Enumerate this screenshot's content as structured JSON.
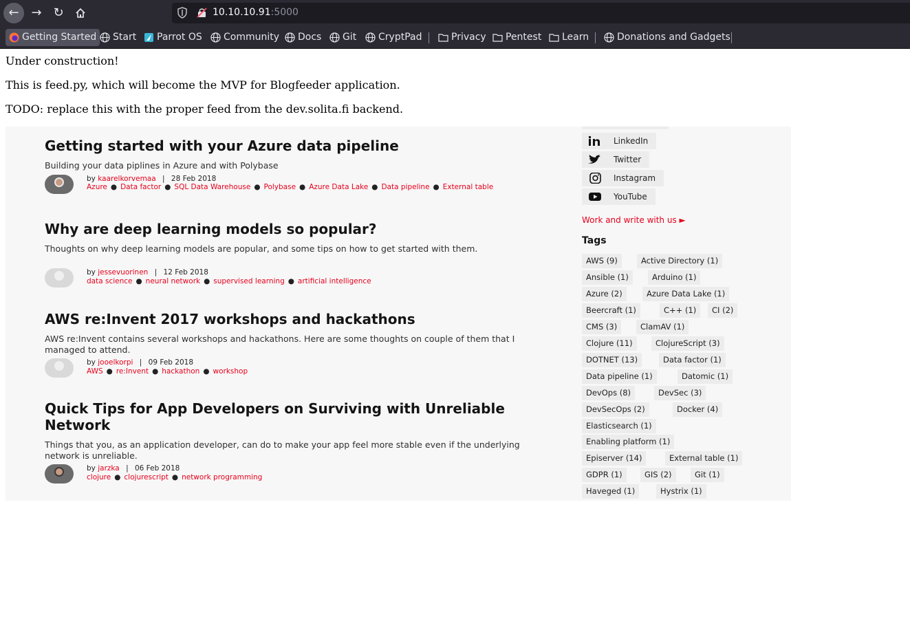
{
  "browser": {
    "url_host": "10.10.10.91",
    "url_port": ":5000",
    "bookmarks": [
      {
        "label": "Getting Started",
        "icon": "firefox-icon"
      },
      {
        "label": "Start",
        "icon": "globe-icon"
      },
      {
        "label": "Parrot OS",
        "icon": "parrot-icon"
      },
      {
        "label": "Community",
        "icon": "globe-icon"
      },
      {
        "label": "Docs",
        "icon": "globe-icon"
      },
      {
        "label": "Git",
        "icon": "globe-icon"
      },
      {
        "label": "CryptPad",
        "icon": "globe-icon"
      },
      {
        "label": "Privacy",
        "icon": "folder-icon"
      },
      {
        "label": "Pentest",
        "icon": "folder-icon"
      },
      {
        "label": "Learn",
        "icon": "folder-icon"
      },
      {
        "label": "Donations and Gadgets",
        "icon": "globe-icon"
      }
    ]
  },
  "page": {
    "line1": "Under construction!",
    "line2": "This is feed.py, which will become the MVP for Blogfeeder application.",
    "line3": "TODO: replace this with the proper feed from the dev.solita.fi backend."
  },
  "blog": {
    "posts": [
      {
        "title": "Getting started with your Azure data pipeline",
        "description": "Building your data piplines in Azure and with Polybase",
        "by": "by",
        "author": "kaarelkorvemaa",
        "sep": "|",
        "date": "28 Feb 2018",
        "tags": [
          "Azure",
          "Data factor",
          "SQL Data Warehouse",
          "Polybase",
          "Azure Data Lake",
          "Data pipeline",
          "External table"
        ]
      },
      {
        "title": "Why are deep learning models so popular?",
        "description": "Thoughts on why deep learning models are popular, and some tips on how to get started with them.",
        "by": "by",
        "author": "jessevuorinen",
        "sep": "|",
        "date": "12 Feb 2018",
        "tags": [
          "data science",
          "neural network",
          "supervised learning",
          "artificial intelligence"
        ]
      },
      {
        "title": "AWS re:Invent 2017 workshops and hackathons",
        "description": "AWS re:Invent contains several workshops and hackathons. Here are some thoughts on couple of them that I managed to attend.",
        "by": "by",
        "author": "jooelkorpi",
        "sep": "|",
        "date": "09 Feb 2018",
        "tags": [
          "AWS",
          "re:Invent",
          "hackathon",
          "workshop"
        ]
      },
      {
        "title": "Quick Tips for App Developers on Surviving with Unreliable Network",
        "description": "Things that you, as an application developer, can do to make your app feel more stable even if the underlying network is unreliable.",
        "by": "by",
        "author": "jarzka",
        "sep": "|",
        "date": "06 Feb 2018",
        "tags": [
          "clojure",
          "clojurescript",
          "network programming"
        ]
      }
    ],
    "social": [
      {
        "label": "LinkedIn",
        "icon": "linkedin-icon"
      },
      {
        "label": "Twitter",
        "icon": "twitter-icon"
      },
      {
        "label": "Instagram",
        "icon": "instagram-icon"
      },
      {
        "label": "YouTube",
        "icon": "youtube-icon"
      }
    ],
    "work_link": "Work and write with us ►",
    "tags_heading": "Tags",
    "tag_rows": [
      [
        "AWS (9)",
        "Active Directory (1)"
      ],
      [
        "Ansible (1)",
        "Arduino (1)"
      ],
      [
        "Azure (2)",
        "Azure Data Lake (1)"
      ],
      [
        "Beercraft (1)",
        "C++ (1)",
        "CI (2)"
      ],
      [
        "CMS (3)",
        "ClamAV (1)"
      ],
      [
        "Clojure (11)",
        "ClojureScript (3)"
      ],
      [
        "DOTNET (13)",
        "Data factor (1)"
      ],
      [
        "Data pipeline (1)",
        "Datomic (1)"
      ],
      [
        "DevOps (8)",
        "DevSec (3)"
      ],
      [
        "DevSecOps (2)",
        "Docker (4)"
      ],
      [
        "Elasticsearch (1)"
      ],
      [
        "Enabling platform (1)"
      ],
      [
        "Episerver (14)",
        "External table (1)"
      ],
      [
        "GDPR (1)",
        "GIS (2)",
        "Git (1)"
      ],
      [
        "Haveged (1)",
        "Hystrix (1)"
      ]
    ],
    "accent_color": "#e6001c"
  }
}
